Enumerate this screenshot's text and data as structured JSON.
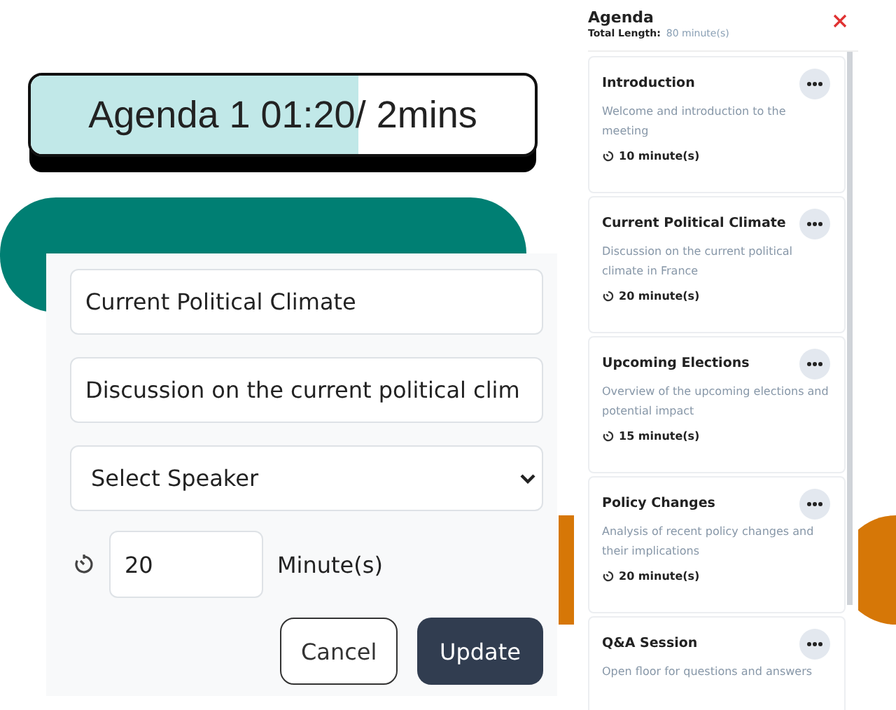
{
  "progress": {
    "label": "Agenda 1 01:20/ 2mins",
    "level": 0.65
  },
  "form": {
    "title_value": "Current Political Climate",
    "description_value": "Discussion on the current political clim",
    "speaker": "Select Speaker",
    "duration": "20",
    "unit": "Minute(s)",
    "buttons": [
      {
        "label": "Cancel",
        "kind": "secondary"
      },
      {
        "label": "Update",
        "kind": "primary"
      }
    ]
  },
  "agenda": {
    "title": "Agenda",
    "total_label": "Total Length:",
    "total_value": "80 minute(s)",
    "items": [
      {
        "title": "Introduction",
        "description": "Welcome and introduction to the meeting",
        "duration": "10 minute(s)"
      },
      {
        "title": "Current Political Climate",
        "description": "Discussion on the current political climate in France",
        "duration": "20 minute(s)"
      },
      {
        "title": "Upcoming Elections",
        "description": "Overview of the upcoming elections and potential impact",
        "duration": "15 minute(s)"
      },
      {
        "title": "Policy Changes",
        "description": "Analysis of recent policy changes and their implications",
        "duration": "20 minute(s)"
      },
      {
        "title": "Q&A Session",
        "description": "Open floor for questions and answers"
      }
    ]
  }
}
